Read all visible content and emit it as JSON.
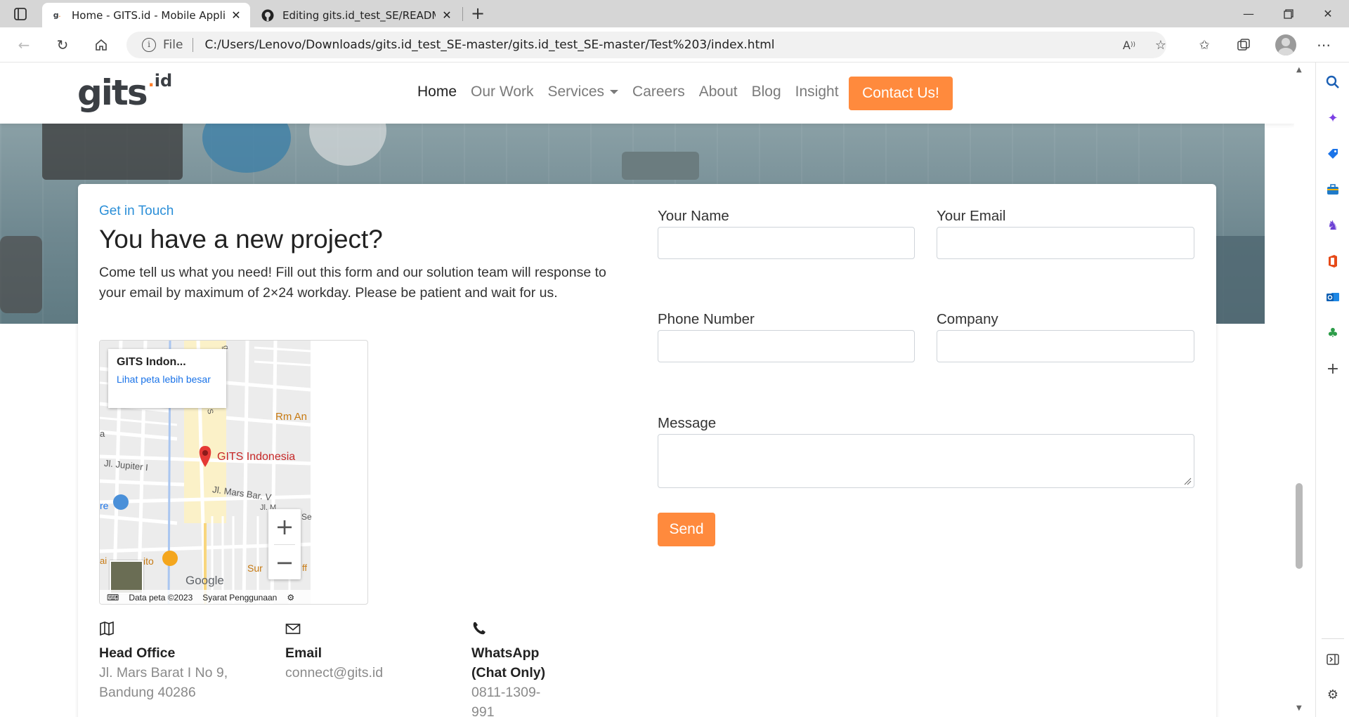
{
  "browser": {
    "tabs": [
      {
        "favicon": "gits-favicon",
        "title": "Home - GITS.id - Mobile Applicati"
      },
      {
        "favicon": "github-icon",
        "title": "Editing gits.id_test_SE/README.m"
      }
    ],
    "address": {
      "prefix": "File",
      "url": "C:/Users/Lenovo/Downloads/gits.id_test_SE-master/gits.id_test_SE-master/Test%203/index.html"
    }
  },
  "nav": {
    "logo_main": "gits",
    "logo_sup_dot": ".",
    "logo_sup": "id",
    "items": [
      "Home",
      "Our Work",
      "Services",
      "Careers",
      "About",
      "Blog",
      "Insight"
    ],
    "contact_label": "Contact Us!"
  },
  "contact": {
    "eyebrow": "Get in Touch",
    "heading": "You have a new project?",
    "description": "Come tell us what you need! Fill out this form and our solution team will response to your email by maximum of 2×24 workday. Please be patient and wait for us."
  },
  "map": {
    "place_name": "GITS Indon...",
    "larger_map_link": "Lihat peta lebih besar",
    "pin_label": "GITS Indonesia",
    "street_labels": [
      "Jl. Jupiter I",
      "Jl. Mars Bar. V",
      "Rm An",
      "Sur",
      "ito",
      "re",
      "a",
      "ai",
      "Se",
      "ff",
      "Jl. M",
      "g",
      "S"
    ],
    "brand": "Google",
    "data_label": "Data peta ©2023",
    "terms_label": "Syarat Penggunaan",
    "zoom_in": "+",
    "zoom_out": "−"
  },
  "offices": [
    {
      "icon": "map-icon",
      "title": "Head Office",
      "value": "Jl. Mars Barat I No 9, Bandung 40286"
    },
    {
      "icon": "mail-icon",
      "title": "Email",
      "value": "connect@gits.id"
    },
    {
      "icon": "phone-icon",
      "title": "WhatsApp (Chat Only)",
      "value": "0811-1309-991"
    }
  ],
  "form": {
    "name_label": "Your Name",
    "name_value": "",
    "email_label": "Your Email",
    "email_value": "",
    "phone_label": "Phone Number",
    "phone_value": "",
    "company_label": "Company",
    "company_value": "",
    "message_label": "Message",
    "message_value": "",
    "send_label": "Send"
  },
  "colors": {
    "accent": "#ff8a3d",
    "link": "#2b8fd8",
    "text": "#222222",
    "muted": "#8a8a8a"
  }
}
